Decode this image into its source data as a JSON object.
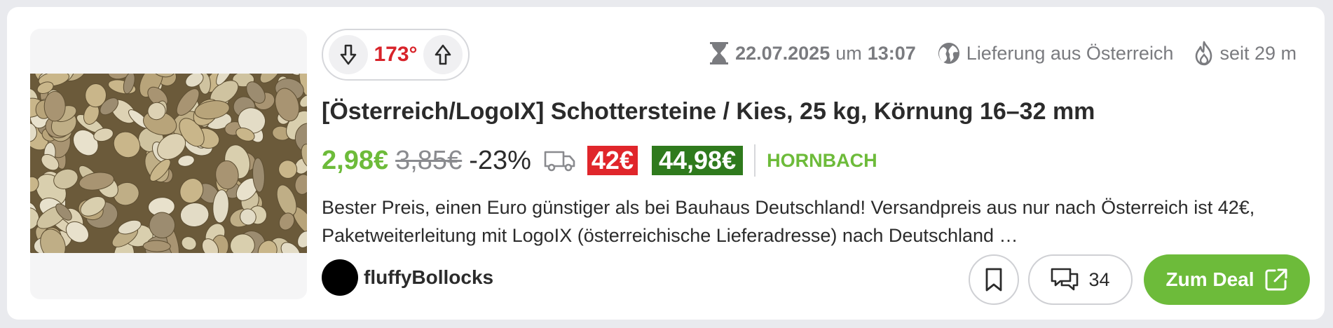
{
  "vote": {
    "temperature": "173°",
    "down_icon": "arrow-down-icon",
    "up_icon": "arrow-up-icon",
    "temperature_color": "#d8232a"
  },
  "meta": {
    "date": "22.07.2025",
    "date_connector": "um",
    "time": "13:07",
    "shipping_origin": "Lieferung aus Österreich",
    "age": "seit 29 m"
  },
  "deal": {
    "title": "[Österreich/LogoIX] Schottersteine / Kies, 25 kg, Körnung 16–32 mm",
    "price": "2,98€",
    "old_price": "3,85€",
    "discount": "-23%",
    "shipping_cost": "42€",
    "total_price": "44,98€",
    "merchant": "HORNBACH",
    "description_line1": "Bester Preis, einen Euro günstiger als bei Bauhaus Deutschland! Versandpreis aus nur nach Österreich ist 42€,",
    "description_line2": "Paketweiterleitung mit LogoIX (österreichische Lieferadresse) nach Deutschland …"
  },
  "user": {
    "name": "fluffyBollocks"
  },
  "actions": {
    "comment_count": "34",
    "deal_button_label": "Zum Deal"
  },
  "colors": {
    "accent_green": "#6dbb3a",
    "badge_red": "#e0262b",
    "badge_dark_green": "#2f7a1d",
    "muted_text": "#7a7b7f"
  }
}
